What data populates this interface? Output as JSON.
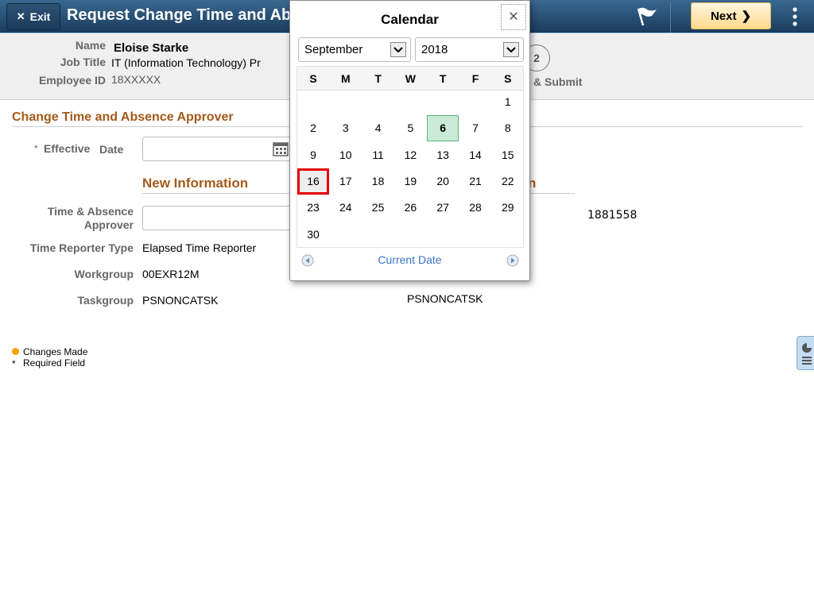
{
  "header": {
    "exit_label": "Exit",
    "title": "Request Change Time and Absence Approver",
    "next_label": "Next"
  },
  "banner": {
    "name_label": "Name",
    "name": "Eloise Starke",
    "job_title_label": "Job Title",
    "job_title": "IT (Information Technology) Pr",
    "employee_id_label": "Employee ID",
    "employee_id": "18XXXXX",
    "step_number": "2",
    "step_label": "& Submit"
  },
  "form": {
    "section_title": "Change Time and Absence Approver",
    "required_marker": "*",
    "effective_label": "Effective",
    "date_label": "Date",
    "effective_date_value": "",
    "new_info_title": "New Information",
    "current_info_title_partial": "n",
    "approver_label_1": "Time & Absence",
    "approver_label_2": "Approver",
    "approver_value": "",
    "current_approver": "1881558",
    "reporter_type_label": "Time Reporter Type",
    "reporter_type": "Elapsed Time Reporter",
    "workgroup_label": "Workgroup",
    "workgroup": "00EXR12M",
    "taskgroup_label": "Taskgroup",
    "taskgroup": "PSNONCATSK",
    "current_taskgroup": "PSNONCATSK"
  },
  "legend": {
    "changes": "Changes Made",
    "required_marker": "*",
    "required": "Required Field",
    "changes_color": "#f5a300"
  },
  "calendar": {
    "title": "Calendar",
    "month": "September",
    "year": "2018",
    "weekdays": [
      "S",
      "M",
      "T",
      "W",
      "T",
      "F",
      "S"
    ],
    "first_weekday": 6,
    "days": 30,
    "today": 6,
    "focused": 16,
    "current_date_label": "Current Date",
    "today_color": "#c8ead6",
    "focus_color": "#e60000"
  }
}
